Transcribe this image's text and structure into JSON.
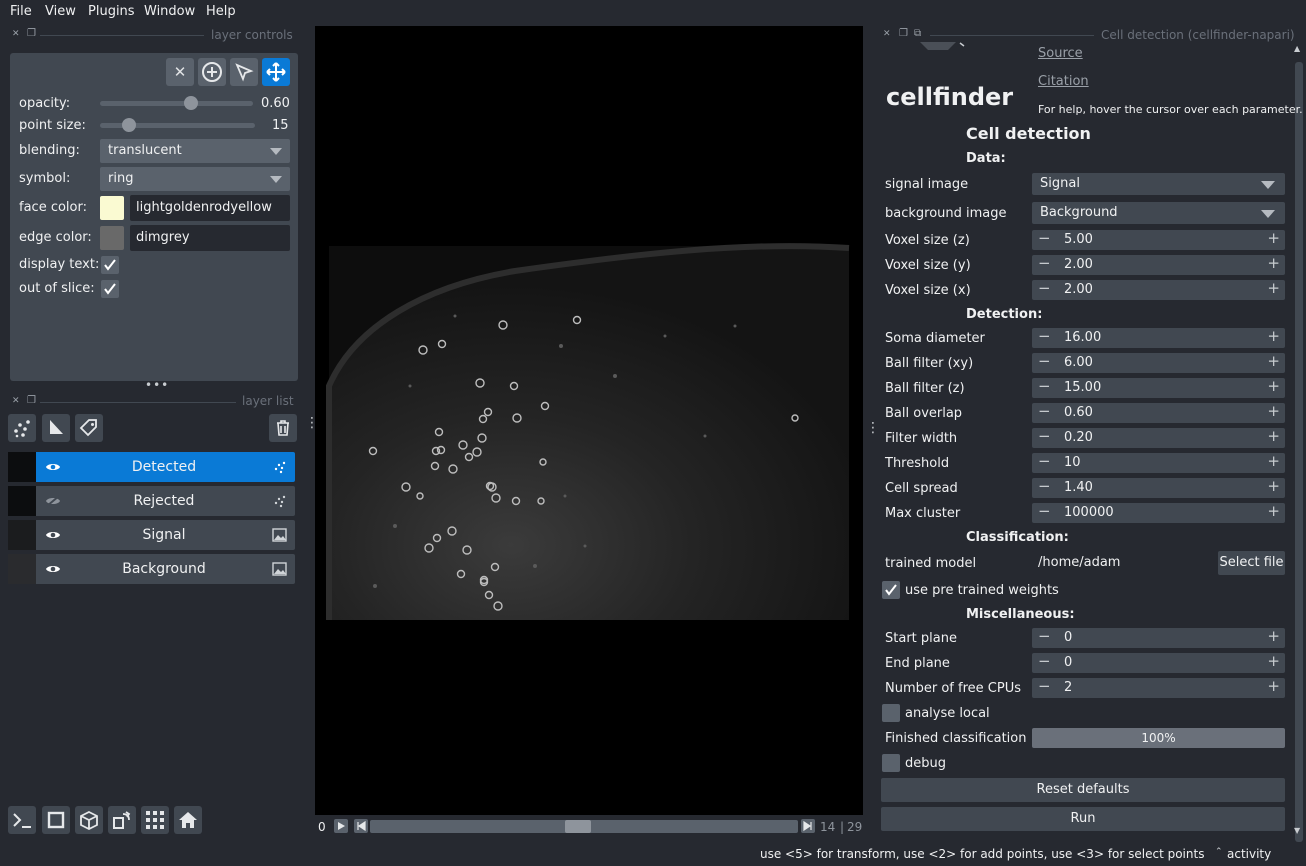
{
  "menu": {
    "file": "File",
    "view": "View",
    "plugins": "Plugins",
    "window": "Window",
    "help": "Help"
  },
  "layer_controls": {
    "title": "layer controls",
    "opacity_label": "opacity:",
    "opacity_value": "0.60",
    "point_size_label": "point size:",
    "point_size_value": "15",
    "blending_label": "blending:",
    "blending_value": "translucent",
    "symbol_label": "symbol:",
    "symbol_value": "ring",
    "face_color_label": "face color:",
    "face_color_value": "lightgoldenrodyellow",
    "face_color_swatch": "#fafad2",
    "edge_color_label": "edge color:",
    "edge_color_value": "dimgrey",
    "edge_color_swatch": "#696969",
    "display_text_label": "display text:",
    "out_of_slice_label": "out of slice:",
    "display_text_checked": true,
    "out_of_slice_checked": true
  },
  "layer_list": {
    "title": "layer list",
    "layers": [
      {
        "name": "Detected",
        "visible": true,
        "selected": true,
        "type": "points"
      },
      {
        "name": "Rejected",
        "visible": false,
        "selected": false,
        "type": "points"
      },
      {
        "name": "Signal",
        "visible": true,
        "selected": false,
        "type": "image"
      },
      {
        "name": "Background",
        "visible": true,
        "selected": false,
        "type": "image"
      }
    ]
  },
  "viewer": {
    "slice_axis_start": "0",
    "slice_current": "14",
    "slice_total": "29"
  },
  "cellfinder": {
    "dock_title": "Cell detection (cellfinder-napari)",
    "source_link": "Source",
    "citation_link": "Citation",
    "app_name": "cellfinder",
    "help_text": "For help, hover the cursor over each parameter.",
    "heading": "Cell detection",
    "data_section": "Data:",
    "signal_image_label": "signal image",
    "signal_image_value": "Signal",
    "background_image_label": "background image",
    "background_image_value": "Background",
    "voxel_z_label": "Voxel size (z)",
    "voxel_z_value": "5.00",
    "voxel_y_label": "Voxel size (y)",
    "voxel_y_value": "2.00",
    "voxel_x_label": "Voxel size (x)",
    "voxel_x_value": "2.00",
    "detection_section": "Detection:",
    "soma_diameter_label": "Soma diameter",
    "soma_diameter_value": "16.00",
    "ball_xy_label": "Ball filter (xy)",
    "ball_xy_value": "6.00",
    "ball_z_label": "Ball filter (z)",
    "ball_z_value": "15.00",
    "ball_overlap_label": "Ball overlap",
    "ball_overlap_value": "0.60",
    "filter_width_label": "Filter width",
    "filter_width_value": "0.20",
    "threshold_label": "Threshold",
    "threshold_value": "10",
    "cell_spread_label": "Cell spread",
    "cell_spread_value": "1.40",
    "max_cluster_label": "Max cluster",
    "max_cluster_value": "100000",
    "classification_section": "Classification:",
    "trained_model_label": "trained model",
    "trained_model_value": "/home/adam",
    "select_file_button": "Select file",
    "pretrained_label": "use pre trained weights",
    "misc_section": "Miscellaneous:",
    "start_plane_label": "Start plane",
    "start_plane_value": "0",
    "end_plane_label": "End plane",
    "end_plane_value": "0",
    "free_cpus_label": "Number of free CPUs",
    "free_cpus_value": "2",
    "analyse_local_label": "analyse local",
    "finished_label": "Finished classification",
    "finished_progress": "100%",
    "debug_label": "debug",
    "reset_button": "Reset defaults",
    "run_button": "Run"
  },
  "status": {
    "hint": "use <5> for transform, use <2> for add points, use <3> for select points",
    "activity": "activity"
  }
}
